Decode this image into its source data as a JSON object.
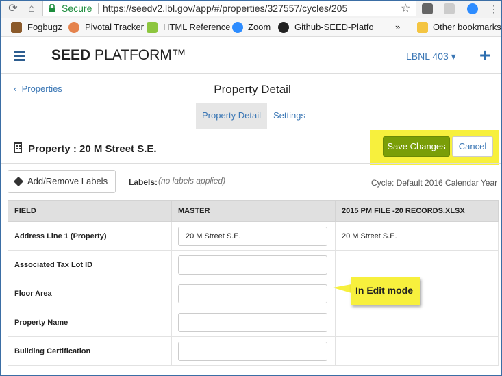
{
  "browser": {
    "secure_label": "Secure",
    "url": "https://seedv2.lbl.gov/app/#/properties/327557/cycles/205",
    "bookmarks": [
      "Fogbugz",
      "Pivotal Tracker",
      "HTML Reference",
      "Zoom",
      "Github-SEED-Platforr"
    ],
    "more_bookmarks": "»",
    "other_bookmarks": "Other bookmarks"
  },
  "header": {
    "brand_bold": "SEED",
    "brand_rest": " PLATFORM™",
    "org": "LBNL 403 ▾",
    "add_icon": "+"
  },
  "page": {
    "back_label": "Properties",
    "title": "Property Detail",
    "tabs": [
      "Property Detail",
      "Settings"
    ],
    "property_title": "Property : 20 M Street S.E.",
    "save_label": "Save Changes",
    "cancel_label": "Cancel",
    "labels_button": "Add/Remove Labels",
    "labels_caption": "Labels:",
    "labels_value": "(no labels applied)",
    "cycle": "Cycle: Default 2016 Calendar Year"
  },
  "table": {
    "headers": [
      "FIELD",
      "MASTER",
      "2015 PM FILE -20 RECORDS.XLSX"
    ],
    "rows": [
      {
        "field": "Address Line 1 (Property)",
        "master": "20 M Street S.E.",
        "file": "20 M Street S.E."
      },
      {
        "field": "Associated Tax Lot ID",
        "master": "",
        "file": ""
      },
      {
        "field": "Floor Area",
        "master": "",
        "file": ""
      },
      {
        "field": "Property Name",
        "master": "",
        "file": ""
      },
      {
        "field": "Building Certification",
        "master": "",
        "file": ""
      }
    ]
  },
  "annotation": {
    "callout": "In Edit mode",
    "highlight_color": "#f7f03d"
  },
  "colors": {
    "save": "#7a9e08",
    "link": "#3b77b5"
  }
}
